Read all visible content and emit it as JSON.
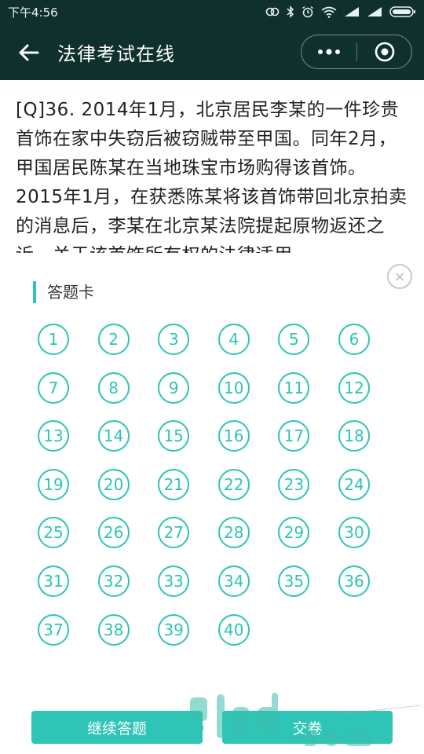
{
  "status_bar": {
    "time": "下午4:56"
  },
  "nav": {
    "title": "法律考试在线"
  },
  "question": {
    "text": "[Q]36.  2014年1月，北京居民李某的一件珍贵首饰在家中失窃后被窃贼带至甲国。同年2月，甲国居民陈某在当地珠宝市场购得该首饰。2015年1月，在获悉陈某将该首饰带回北京拍卖的消息后，李某在北京某法院提起原物返还之诉。关于该首饰所有权的法律适用，"
  },
  "answer_card": {
    "title": "答题卡",
    "close_glyph": "×",
    "numbers": [
      "1",
      "2",
      "3",
      "4",
      "5",
      "6",
      "7",
      "8",
      "9",
      "10",
      "11",
      "12",
      "13",
      "14",
      "15",
      "16",
      "17",
      "18",
      "19",
      "20",
      "21",
      "22",
      "23",
      "24",
      "25",
      "26",
      "27",
      "28",
      "29",
      "30",
      "31",
      "32",
      "33",
      "34",
      "35",
      "36",
      "37",
      "38",
      "39",
      "40"
    ],
    "accent_color": "#2ec4b6"
  },
  "buttons": {
    "continue_label": "继续答题",
    "submit_label": "交卷"
  },
  "colors": {
    "nav_bg": "#0f302d",
    "accent": "#2ec4b6"
  }
}
